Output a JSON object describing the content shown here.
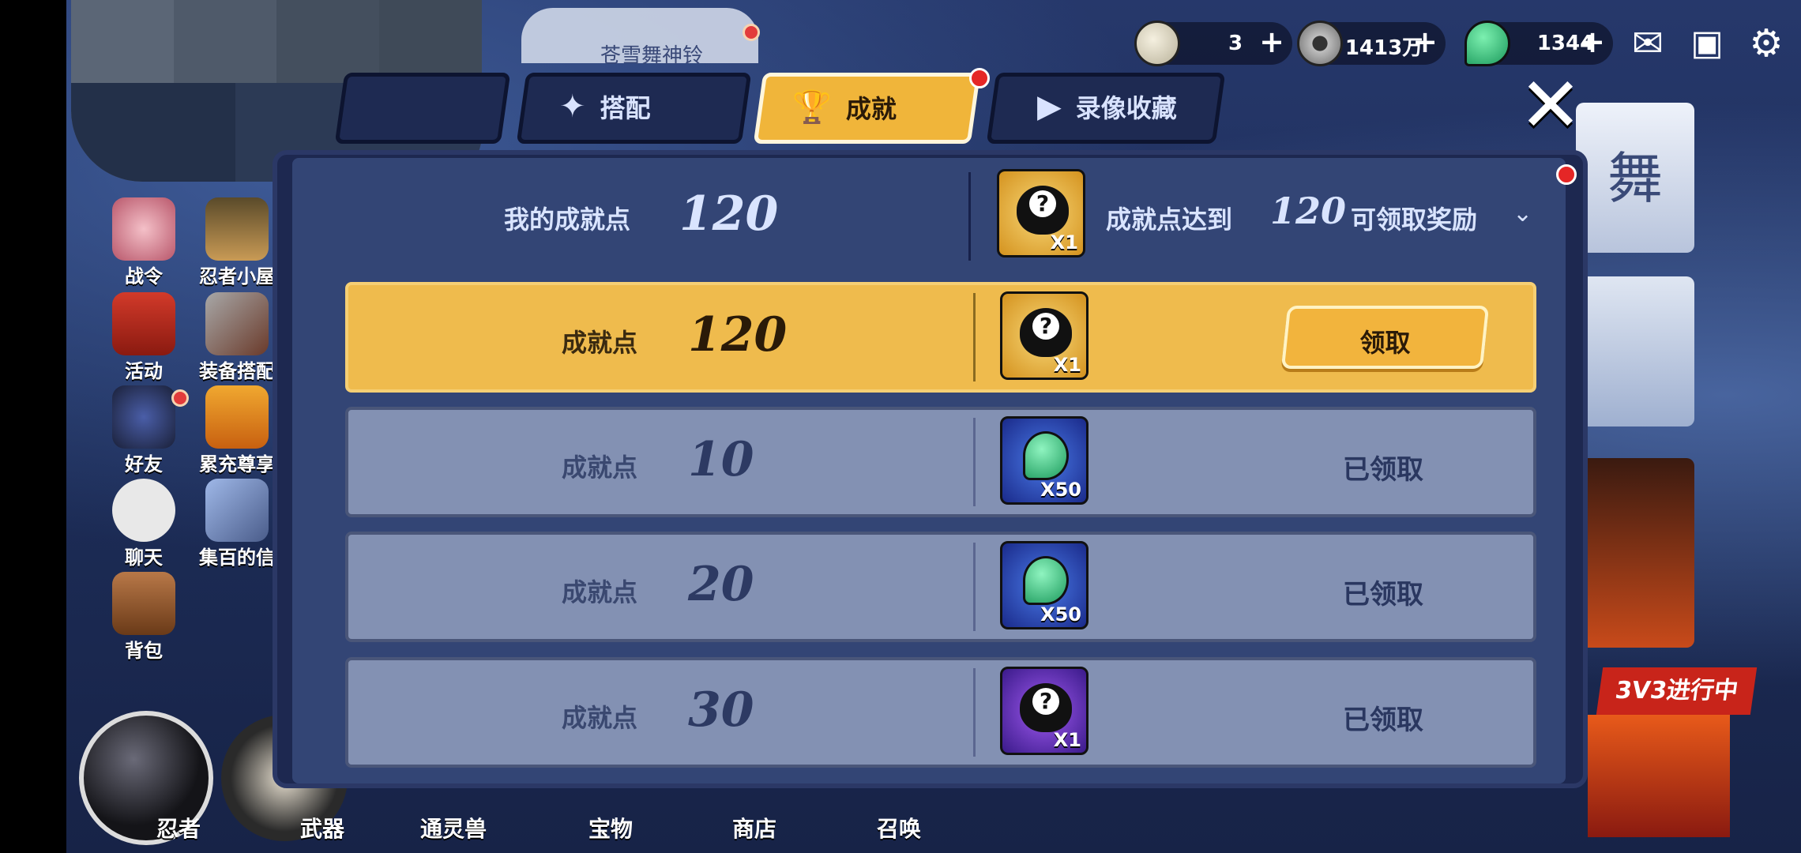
{
  "top_banner": {
    "text": "苍雪舞神铃"
  },
  "resources": [
    {
      "icon": "rice-ball-icon",
      "value": "3"
    },
    {
      "icon": "coin-icon",
      "value": "1413万"
    },
    {
      "icon": "green-magatama-icon",
      "value": "1344"
    }
  ],
  "top_icons": [
    "mail-icon",
    "shop-chest-icon",
    "settings-gear-icon"
  ],
  "sidebar": {
    "items": [
      {
        "label": "战令",
        "icon": "battle-pass-icon"
      },
      {
        "label": "忍者小屋",
        "icon": "ninja-house-icon"
      },
      {
        "label": "活动",
        "icon": "torii-gate-icon"
      },
      {
        "label": "装备搭配",
        "icon": "equipment-icon"
      },
      {
        "label": "好友",
        "icon": "ninja-friend-icon"
      },
      {
        "label": "累充尊享",
        "icon": "ssr-chest-icon"
      },
      {
        "label": "聊天",
        "icon": "chat-bubble-icon"
      },
      {
        "label": "集百的信",
        "icon": "letter-icon"
      },
      {
        "label": "背包",
        "icon": "backpack-icon"
      }
    ]
  },
  "bottom_nav": [
    {
      "label": "忍者"
    },
    {
      "label": "武器"
    },
    {
      "label": "通灵兽"
    },
    {
      "label": "宝物"
    },
    {
      "label": "商店"
    },
    {
      "label": "召唤"
    }
  ],
  "right_deco": {
    "banner_text": "3V3进行中",
    "calligraphy": "舞"
  },
  "tabs": [
    {
      "label": "",
      "icon": ""
    },
    {
      "label": "搭配",
      "icon": "shuriken-icon"
    },
    {
      "label": "成就",
      "icon": "trophy-icon",
      "active": true
    },
    {
      "label": "录像收藏",
      "icon": "play-icon"
    }
  ],
  "summary": {
    "label": "我的成就点",
    "value": "120",
    "reward_prefix": "成就点达到",
    "reward_points": "120",
    "reward_suffix": "可领取奖励",
    "reward_qty": "X1"
  },
  "rewards": [
    {
      "label": "成就点",
      "points": "120",
      "item": "mystery-box",
      "qty": "X1",
      "status": "claimable",
      "action": "领取"
    },
    {
      "label": "成就点",
      "points": "10",
      "item": "green-magatama",
      "qty": "X50",
      "status": "已领取"
    },
    {
      "label": "成就点",
      "points": "20",
      "item": "green-magatama",
      "qty": "X50",
      "status": "已领取"
    },
    {
      "label": "成就点",
      "points": "30",
      "item": "purple-mystery-box",
      "qty": "X1",
      "status": "已领取"
    }
  ],
  "colors": {
    "accent_gold": "#efbb4d",
    "panel": "#334575",
    "claimed_row": "#8391b3",
    "notify_red": "#e52626"
  }
}
